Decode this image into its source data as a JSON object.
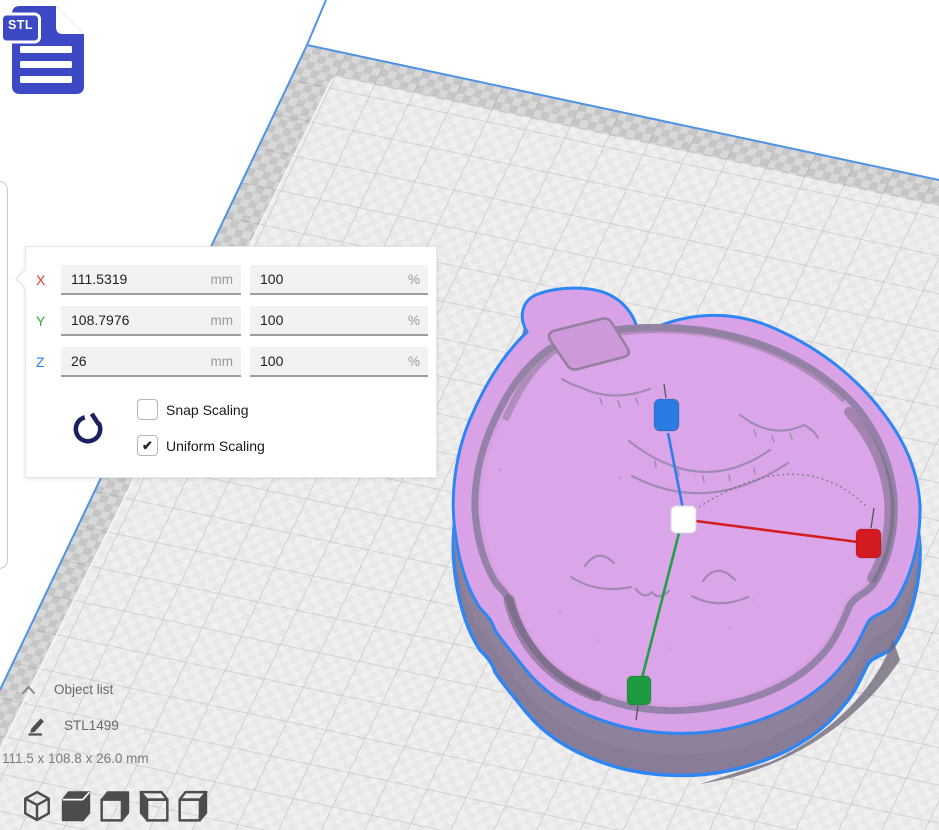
{
  "file_badge": {
    "label": "STL"
  },
  "scale_panel": {
    "axes": [
      {
        "label": "X",
        "value": "111.5319",
        "unit": "mm",
        "percent": "100",
        "percent_unit": "%"
      },
      {
        "label": "Y",
        "value": "108.7976",
        "unit": "mm",
        "percent": "100",
        "percent_unit": "%"
      },
      {
        "label": "Z",
        "value": "26",
        "unit": "mm",
        "percent": "100",
        "percent_unit": "%"
      }
    ],
    "checkboxes": [
      {
        "label": "Snap Scaling",
        "glyph": ""
      },
      {
        "label": "Uniform Scaling",
        "glyph": "✔"
      }
    ]
  },
  "object_list": {
    "header": "Object list",
    "item_name": "STL1499",
    "dimensions": "111.5 x 108.8 x 26.0 mm"
  },
  "view_toolbar": {
    "buttons": [
      "3d-view",
      "front-view",
      "top-view",
      "left-side-view",
      "right-side-view"
    ]
  },
  "colors": {
    "axis_x": "#d63a34",
    "axis_y": "#3aa83a",
    "axis_z": "#2e7bf2",
    "selection_outline": "#2f86f2",
    "model_surface": "#d9a2e6",
    "handle_x": "#d41920",
    "handle_y": "#1e9b41",
    "handle_z": "#2b7ce2",
    "handle_center": "#ffffff"
  }
}
